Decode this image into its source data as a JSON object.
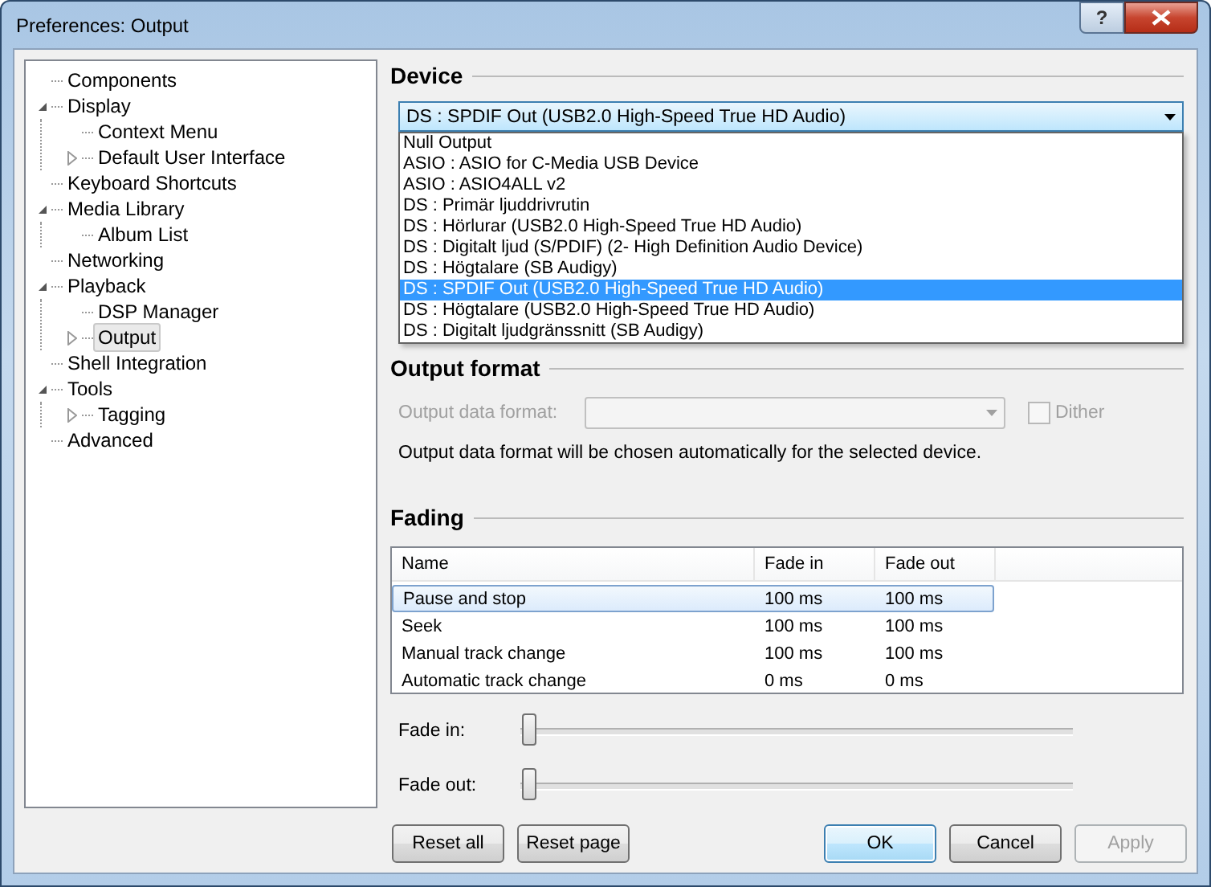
{
  "window": {
    "title": "Preferences: Output",
    "help_button": "?"
  },
  "tree": [
    {
      "label": "Components",
      "selected": false
    },
    {
      "label": "Display",
      "selected": false,
      "expanded": true,
      "children": [
        {
          "label": "Context Menu",
          "selected": false
        },
        {
          "label": "Default User Interface",
          "selected": false,
          "expanded": false
        }
      ]
    },
    {
      "label": "Keyboard Shortcuts",
      "selected": false
    },
    {
      "label": "Media Library",
      "selected": false,
      "expanded": true,
      "children": [
        {
          "label": "Album List",
          "selected": false
        }
      ]
    },
    {
      "label": "Networking",
      "selected": false
    },
    {
      "label": "Playback",
      "selected": false,
      "expanded": true,
      "children": [
        {
          "label": "DSP Manager",
          "selected": false
        },
        {
          "label": "Output",
          "selected": true,
          "expanded": false
        }
      ]
    },
    {
      "label": "Shell Integration",
      "selected": false
    },
    {
      "label": "Tools",
      "selected": false,
      "expanded": true,
      "children": [
        {
          "label": "Tagging",
          "selected": false,
          "expanded": false
        }
      ]
    },
    {
      "label": "Advanced",
      "selected": false
    }
  ],
  "device": {
    "heading": "Device",
    "value": "DS : SPDIF Out (USB2.0 High-Speed True HD Audio)",
    "expanded": true,
    "options": [
      {
        "label": "Null Output",
        "selected": false
      },
      {
        "label": "ASIO : ASIO for C-Media USB Device",
        "selected": false
      },
      {
        "label": "ASIO : ASIO4ALL v2",
        "selected": false
      },
      {
        "label": "DS : Primär ljuddrivrutin",
        "selected": false
      },
      {
        "label": "DS : Hörlurar (USB2.0 High-Speed True HD Audio)",
        "selected": false
      },
      {
        "label": "DS : Digitalt ljud (S/PDIF) (2- High Definition Audio Device)",
        "selected": false
      },
      {
        "label": "DS : Högtalare (SB Audigy)",
        "selected": false
      },
      {
        "label": "DS : SPDIF Out (USB2.0 High-Speed True HD Audio)",
        "selected": true
      },
      {
        "label": "DS : Högtalare (USB2.0 High-Speed True HD Audio)",
        "selected": false
      },
      {
        "label": "DS : Digitalt ljudgränssnitt (SB Audigy)",
        "selected": false
      }
    ]
  },
  "output_format": {
    "heading": "Output format",
    "field_label": "Output data format:",
    "disabled": true,
    "dither": {
      "label": "Dither",
      "checked": false
    },
    "note": "Output data format will be chosen automatically for the selected device."
  },
  "fading": {
    "heading": "Fading",
    "table": {
      "columns": [
        "Name",
        "Fade in",
        "Fade out"
      ],
      "rows": [
        {
          "cells": [
            "Pause and stop",
            "100 ms",
            "100 ms"
          ],
          "selected": true
        },
        {
          "cells": [
            "Seek",
            "100 ms",
            "100 ms"
          ],
          "selected": false
        },
        {
          "cells": [
            "Manual track change",
            "100 ms",
            "100 ms"
          ],
          "selected": false
        },
        {
          "cells": [
            "Automatic track change",
            "0 ms",
            "0 ms"
          ],
          "selected": false
        }
      ]
    },
    "sliders": [
      {
        "label": "Fade in:",
        "level": 0
      },
      {
        "label": "Fade out:",
        "level": 0
      }
    ]
  },
  "buttons": [
    {
      "label": "Reset all",
      "default": false,
      "disabled": false
    },
    {
      "label": "Reset page",
      "default": false,
      "disabled": false
    },
    {
      "label": "OK",
      "default": true,
      "disabled": false
    },
    {
      "label": "Cancel",
      "default": false,
      "disabled": false
    },
    {
      "label": "Apply",
      "default": false,
      "disabled": true
    }
  ]
}
